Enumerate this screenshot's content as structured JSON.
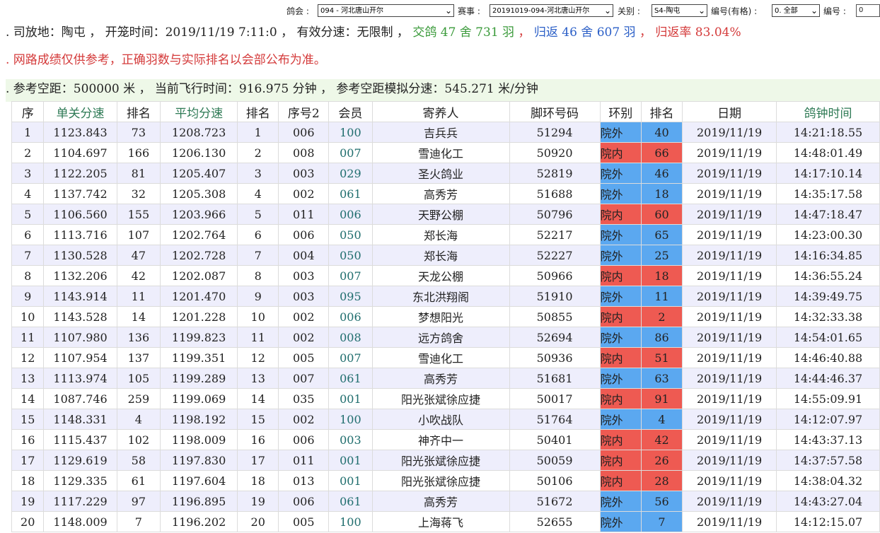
{
  "filters": {
    "club_label": "鸽会 :",
    "club_value": "094 - 河北唐山开尔",
    "race_label": "赛事 :",
    "race_value": "20191019-094-河北唐山开尔",
    "gate_label": "关别 :",
    "gate_value": "S4-陶屯",
    "code_label": "编号(有格) :",
    "code_value": "0. 全部",
    "num_label": "编号 :",
    "num_value": "0"
  },
  "info": {
    "line1": {
      "prefix": ". 司放地：陶屯 ， 开笼时间：2019/11/19 7:11:0 ， 有效分速：无限制 ，",
      "entered": "交鸽 47 舍 731 羽",
      "sep1": "，",
      "returned": "归返 46 舍 607 羽",
      "sep2": "，",
      "rate": "归返率 83.04%"
    },
    "line2": ". 网路成绩仅供参考，正确羽数与实际排名以会部公布为准。",
    "line3": ". 参考空距：500000 米 ， 当前飞行时间：916.975 分钟 ， 参考空距模拟分速：545.271 米/分钟"
  },
  "headers": [
    "序",
    "单关分速",
    "排名",
    "平均分速",
    "排名",
    "序号2",
    "会员",
    "寄养人",
    "脚环号码",
    "环别",
    "排名",
    "日期",
    "鸽钟时间"
  ],
  "colors": {
    "ring_in": "#ee5a52",
    "ring_out": "#5ba8f0",
    "row_alt": "#eeeefc"
  },
  "rows": [
    [
      "1",
      "1123.843",
      "73",
      "1208.723",
      "1",
      "006",
      "100",
      "吉兵兵",
      "51294",
      "院外",
      "40",
      "2019/11/19",
      "14:21:18.55"
    ],
    [
      "2",
      "1104.697",
      "166",
      "1206.130",
      "2",
      "008",
      "007",
      "雪迪化工",
      "50920",
      "院内",
      "66",
      "2019/11/19",
      "14:48:01.49"
    ],
    [
      "3",
      "1122.205",
      "81",
      "1205.407",
      "3",
      "003",
      "029",
      "圣火鸽业",
      "52819",
      "院外",
      "46",
      "2019/11/19",
      "14:17:10.14"
    ],
    [
      "4",
      "1137.742",
      "32",
      "1205.308",
      "4",
      "002",
      "061",
      "高秀芳",
      "51688",
      "院外",
      "18",
      "2019/11/19",
      "14:35:17.58"
    ],
    [
      "5",
      "1106.560",
      "155",
      "1203.966",
      "5",
      "011",
      "006",
      "天野公棚",
      "50796",
      "院内",
      "60",
      "2019/11/19",
      "14:47:18.47"
    ],
    [
      "6",
      "1113.716",
      "107",
      "1202.764",
      "6",
      "006",
      "050",
      "郑长海",
      "52217",
      "院外",
      "65",
      "2019/11/19",
      "14:23:00.30"
    ],
    [
      "7",
      "1130.528",
      "47",
      "1202.728",
      "7",
      "004",
      "050",
      "郑长海",
      "52227",
      "院外",
      "25",
      "2019/11/19",
      "14:16:34.85"
    ],
    [
      "8",
      "1132.206",
      "42",
      "1202.087",
      "8",
      "003",
      "007",
      "天龙公棚",
      "50966",
      "院内",
      "18",
      "2019/11/19",
      "14:36:55.24"
    ],
    [
      "9",
      "1143.914",
      "11",
      "1201.470",
      "9",
      "003",
      "095",
      "东北洪翔阁",
      "51910",
      "院外",
      "11",
      "2019/11/19",
      "14:39:49.75"
    ],
    [
      "10",
      "1143.528",
      "14",
      "1201.228",
      "10",
      "002",
      "006",
      "梦想阳光",
      "50855",
      "院内",
      "2",
      "2019/11/19",
      "14:32:33.38"
    ],
    [
      "11",
      "1107.980",
      "136",
      "1199.823",
      "11",
      "002",
      "008",
      "远方鸽舍",
      "52694",
      "院外",
      "86",
      "2019/11/19",
      "14:54:01.65"
    ],
    [
      "12",
      "1107.954",
      "137",
      "1199.351",
      "12",
      "005",
      "007",
      "雪迪化工",
      "50936",
      "院内",
      "51",
      "2019/11/19",
      "14:46:40.88"
    ],
    [
      "13",
      "1113.974",
      "105",
      "1199.289",
      "13",
      "007",
      "061",
      "高秀芳",
      "51681",
      "院外",
      "63",
      "2019/11/19",
      "14:44:46.37"
    ],
    [
      "14",
      "1087.746",
      "259",
      "1199.069",
      "14",
      "035",
      "001",
      "阳光张斌徐应捷",
      "50017",
      "院内",
      "91",
      "2019/11/19",
      "14:55:09.91"
    ],
    [
      "15",
      "1148.331",
      "4",
      "1198.192",
      "15",
      "002",
      "100",
      "小吹战队",
      "51764",
      "院外",
      "4",
      "2019/11/19",
      "14:12:07.97"
    ],
    [
      "16",
      "1115.437",
      "102",
      "1198.009",
      "16",
      "006",
      "003",
      "神齐中一",
      "50401",
      "院内",
      "42",
      "2019/11/19",
      "14:43:37.13"
    ],
    [
      "17",
      "1129.619",
      "58",
      "1197.830",
      "17",
      "011",
      "001",
      "阳光张斌徐应捷",
      "50059",
      "院内",
      "26",
      "2019/11/19",
      "14:37:57.58"
    ],
    [
      "18",
      "1129.335",
      "61",
      "1197.604",
      "18",
      "013",
      "001",
      "阳光张斌徐应捷",
      "50106",
      "院内",
      "28",
      "2019/11/19",
      "14:38:04.32"
    ],
    [
      "19",
      "1117.229",
      "97",
      "1196.895",
      "19",
      "006",
      "061",
      "高秀芳",
      "51672",
      "院外",
      "56",
      "2019/11/19",
      "14:43:27.04"
    ],
    [
      "20",
      "1148.009",
      "7",
      "1196.202",
      "20",
      "005",
      "100",
      "上海蒋飞",
      "52655",
      "院外",
      "7",
      "2019/11/19",
      "14:12:15.07"
    ]
  ]
}
